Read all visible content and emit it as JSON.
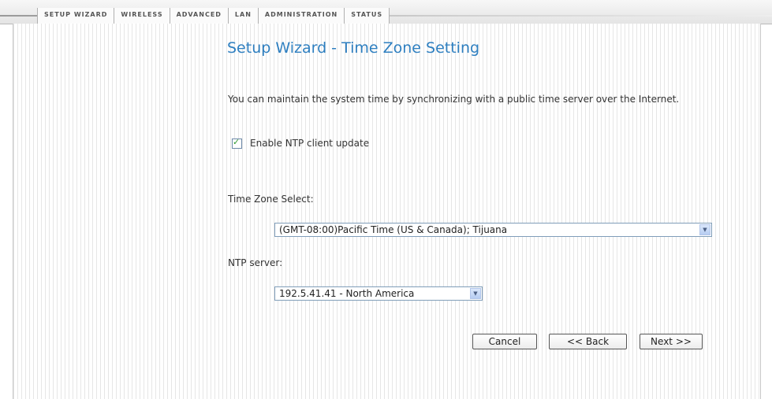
{
  "nav": {
    "tabs": [
      "Setup Wizard",
      "Wireless",
      "Advanced",
      "LAN",
      "Administration",
      "Status"
    ]
  },
  "page": {
    "title": "Setup Wizard - Time Zone Setting",
    "description": "You can maintain the system time by synchronizing with a public time server over the Internet."
  },
  "form": {
    "ntp_enable": {
      "label": "Enable NTP client update",
      "checked": true,
      "tick": "✓"
    },
    "time_zone": {
      "label": "Time Zone Select:",
      "value": "(GMT-08:00)Pacific Time (US & Canada); Tijuana"
    },
    "ntp_server": {
      "label": "NTP server:",
      "value": "192.5.41.41 - North America"
    },
    "dropdown_arrow": "▼"
  },
  "buttons": {
    "cancel": "Cancel",
    "back": "<< Back",
    "next": "Next >>"
  }
}
